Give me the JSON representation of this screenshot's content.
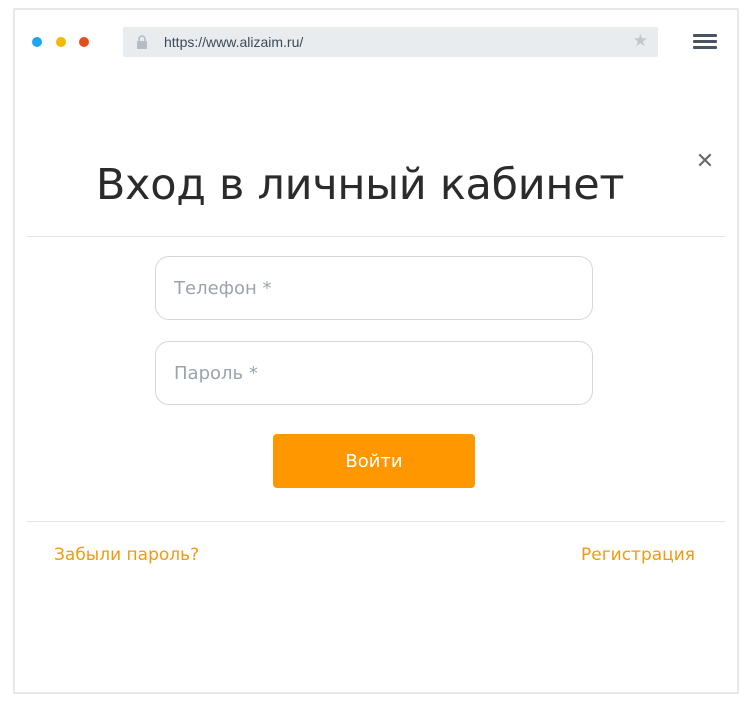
{
  "browser": {
    "url": "https://www.alizaim.ru/",
    "traffic_lights": {
      "blue": "#1ea7f0",
      "yellow": "#f5b800",
      "red": "#e54d1f"
    },
    "icons": {
      "lock": "lock-icon",
      "bookmark": "star-icon",
      "menu": "hamburger-menu-icon"
    }
  },
  "modal": {
    "title": "Вход в личный кабинет",
    "close_glyph": "✕",
    "phone": {
      "placeholder": "Телефон *",
      "value": ""
    },
    "password": {
      "placeholder": "Пароль *",
      "value": ""
    },
    "submit_label": "Войти",
    "forgot_label": "Забыли пароль?",
    "register_label": "Регистрация"
  },
  "colors": {
    "accent": "#ff9800",
    "link": "#f29a0e",
    "title": "#2b2b2b",
    "placeholder": "#9aa3ae"
  }
}
